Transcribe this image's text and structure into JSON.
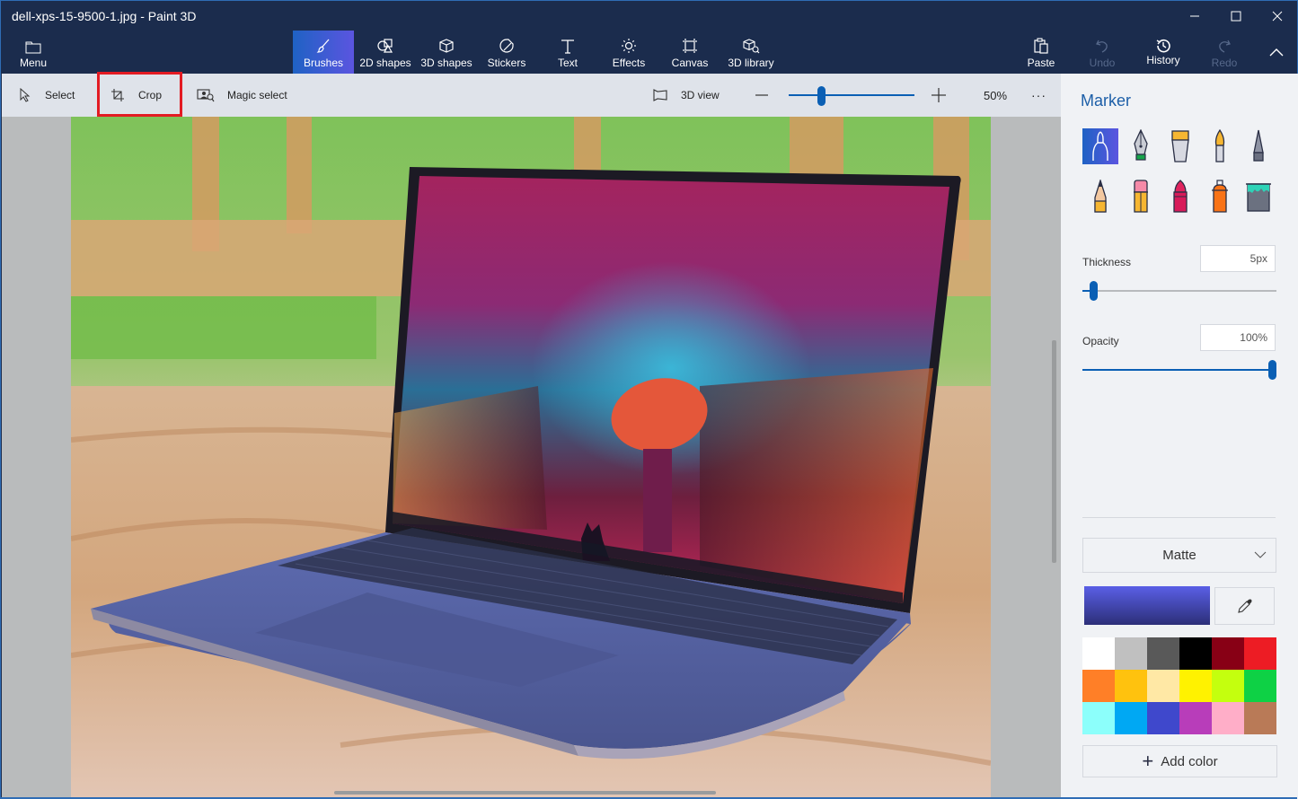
{
  "window": {
    "title": "dell-xps-15-9500-1.jpg - Paint 3D",
    "controls": {
      "minimize": "minimize",
      "maximize": "maximize",
      "close": "close"
    }
  },
  "ribbon": {
    "menu": {
      "label": "Menu",
      "icon": "folder-icon"
    },
    "tools": [
      {
        "label": "Brushes",
        "icon": "brush-icon",
        "active": true
      },
      {
        "label": "2D shapes",
        "icon": "2d-shapes-icon",
        "active": false
      },
      {
        "label": "3D shapes",
        "icon": "3d-cube-icon",
        "active": false
      },
      {
        "label": "Stickers",
        "icon": "sticker-icon",
        "active": false
      },
      {
        "label": "Text",
        "icon": "text-icon",
        "active": false
      },
      {
        "label": "Effects",
        "icon": "sun-icon",
        "active": false
      },
      {
        "label": "Canvas",
        "icon": "canvas-icon",
        "active": false
      },
      {
        "label": "3D library",
        "icon": "3d-library-icon",
        "active": false
      }
    ],
    "right": [
      {
        "label": "Paste",
        "icon": "paste-icon",
        "enabled": true
      },
      {
        "label": "Undo",
        "icon": "undo-icon",
        "enabled": false
      },
      {
        "label": "History",
        "icon": "history-icon",
        "enabled": true
      },
      {
        "label": "Redo",
        "icon": "redo-icon",
        "enabled": false
      }
    ],
    "collapse_icon": "chevron-up-icon"
  },
  "toolbar": {
    "select_label": "Select",
    "crop_label": "Crop",
    "magic_select_label": "Magic select",
    "view3d_label": "3D view",
    "zoom_value": "50%",
    "zoom_fraction": 0.25,
    "more_label": "···"
  },
  "canvas": {
    "image_description": "Dell XPS 15 9500 laptop on wooden table, colorful anime street wallpaper on screen"
  },
  "panel": {
    "title": "Marker",
    "brushes": [
      {
        "name": "marker",
        "selected": true
      },
      {
        "name": "calligraphy-pen",
        "selected": false
      },
      {
        "name": "oil-brush",
        "selected": false
      },
      {
        "name": "watercolor",
        "selected": false
      },
      {
        "name": "pixel-pen",
        "selected": false
      },
      {
        "name": "pencil",
        "selected": false
      },
      {
        "name": "eraser",
        "selected": false
      },
      {
        "name": "crayon",
        "selected": false
      },
      {
        "name": "spray-can",
        "selected": false
      },
      {
        "name": "fill",
        "selected": false
      }
    ],
    "thickness": {
      "label": "Thickness",
      "value": "5px",
      "fraction": 0.04
    },
    "opacity": {
      "label": "Opacity",
      "value": "100%",
      "fraction": 1.0
    },
    "finish": {
      "selected": "Matte"
    },
    "current_color": {
      "top": "#5a5fe6",
      "bottom": "#2c2f78"
    },
    "palette": [
      "#ffffff",
      "#c0c0c0",
      "#595959",
      "#000000",
      "#880015",
      "#ed1c24",
      "#ff7f27",
      "#ffc20e",
      "#ffe8a5",
      "#fff200",
      "#c4ff0e",
      "#0ed145",
      "#8cfffb",
      "#00a8f3",
      "#3f48cc",
      "#b83dba",
      "#ffaec8",
      "#b97a57"
    ],
    "add_color_label": "Add color"
  },
  "colors": {
    "accent": "#0a5fb4",
    "title_bar": "#1b2c4d",
    "crop_highlight": "#e31b23",
    "panel_title": "#1d5fa8"
  }
}
